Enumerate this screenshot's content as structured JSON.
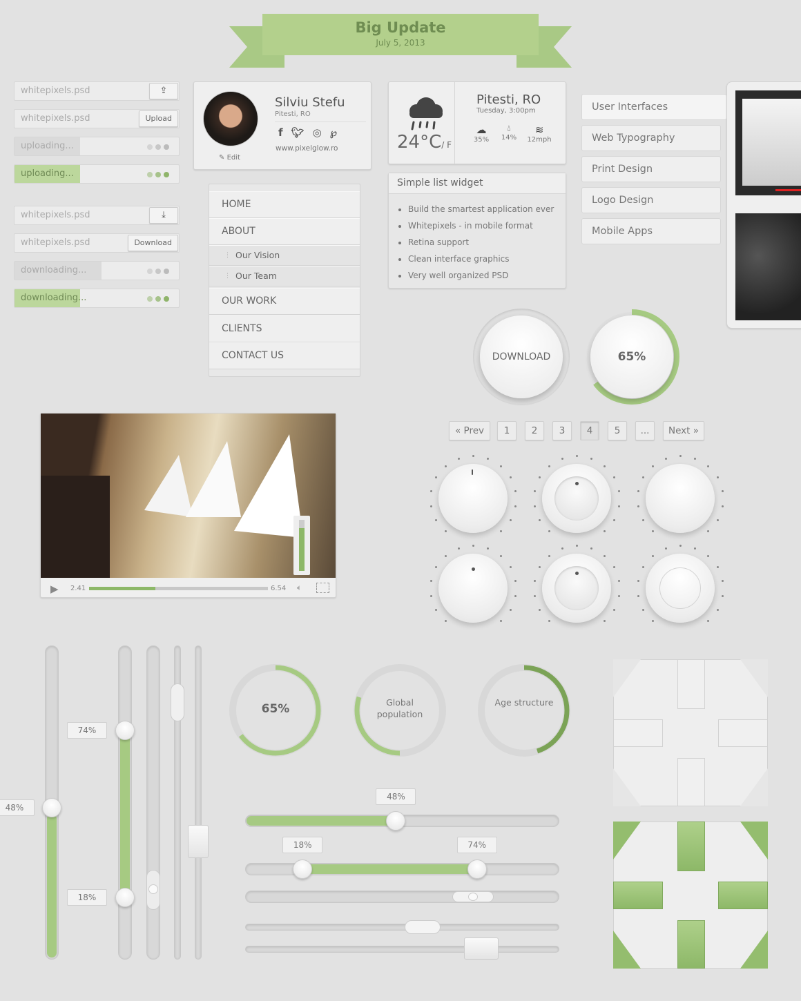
{
  "banner": {
    "title": "Big Update",
    "date": "July 5, 2013"
  },
  "inputs": [
    {
      "value": "whitepixels.psd",
      "button_icon": "upload-icon",
      "progress": null
    },
    {
      "value": "whitepixels.psd",
      "button": "Upload",
      "progress": null
    },
    {
      "value": "uploading...",
      "progress": 40,
      "state": "inactive"
    },
    {
      "value": "uploading...",
      "progress": 40,
      "state": "active"
    },
    {
      "value": "whitepixels.psd",
      "button_icon": "download-icon",
      "progress": null
    },
    {
      "value": "whitepixels.psd",
      "button": "Download",
      "progress": null
    },
    {
      "value": "downloading...",
      "progress": 53,
      "state": "inactive"
    },
    {
      "value": "downloading...",
      "progress": 40,
      "state": "active"
    }
  ],
  "profile": {
    "name": "Silviu Stefu",
    "location": "Pitesti, RO",
    "website": "www.pixelglow.ro",
    "edit": "Edit",
    "social": [
      "facebook-icon",
      "twitter-icon",
      "dribbble-icon",
      "pinterest-icon"
    ]
  },
  "nav": {
    "items": [
      {
        "label": "HOME"
      },
      {
        "label": "ABOUT"
      },
      {
        "label": "Our Vision",
        "sub": true
      },
      {
        "label": "Our Team",
        "sub": true
      },
      {
        "label": "OUR WORK"
      },
      {
        "label": "CLIENTS"
      },
      {
        "label": "CONTACT US"
      }
    ]
  },
  "weather": {
    "temp": "24°C",
    "unit_alt": "/ F",
    "city": "Pitesti, RO",
    "time": "Tuesday, 3:00pm",
    "stats": [
      {
        "icon": "rain-cloud-icon",
        "value": "35%"
      },
      {
        "icon": "droplets-icon",
        "value": "14%"
      },
      {
        "icon": "wind-icon",
        "value": "12mph"
      }
    ]
  },
  "list_widget": {
    "title": "Simple list widget",
    "items": [
      "Build the smartest application ever",
      "Whitepixels - in mobile format",
      "Retina support",
      "Clean interface graphics",
      "Very well organized PSD"
    ]
  },
  "categories": [
    "User Interfaces",
    "Web Typography",
    "Print Design",
    "Logo Design",
    "Mobile Apps"
  ],
  "round_buttons": {
    "download": "DOWNLOAD",
    "progress_label": "65%",
    "progress": 65
  },
  "pagination": {
    "prev": "« Prev",
    "pages": [
      "1",
      "2",
      "3",
      "4",
      "5",
      "..."
    ],
    "active": "4",
    "next": "Next »"
  },
  "video": {
    "current": "2.41",
    "duration": "6.54",
    "progress": 37,
    "volume": 80
  },
  "vsliders": [
    {
      "value": 48,
      "label": "48%"
    },
    {
      "range": [
        18,
        74
      ],
      "labels": [
        "18%",
        "74%"
      ]
    }
  ],
  "donuts": [
    {
      "label": "65%",
      "value": 65
    },
    {
      "label": "Global population",
      "value": 30
    },
    {
      "label": "Age structure",
      "value": 45
    }
  ],
  "hsliders": [
    {
      "value": 48,
      "label": "48%"
    },
    {
      "range": [
        18,
        74
      ],
      "labels": [
        "18%",
        "74%"
      ]
    }
  ],
  "colors": {
    "accent": "#a6ca82",
    "accent_dark": "#7ba356",
    "banner": "#b3d08c",
    "bg": "#e2e2e2"
  }
}
